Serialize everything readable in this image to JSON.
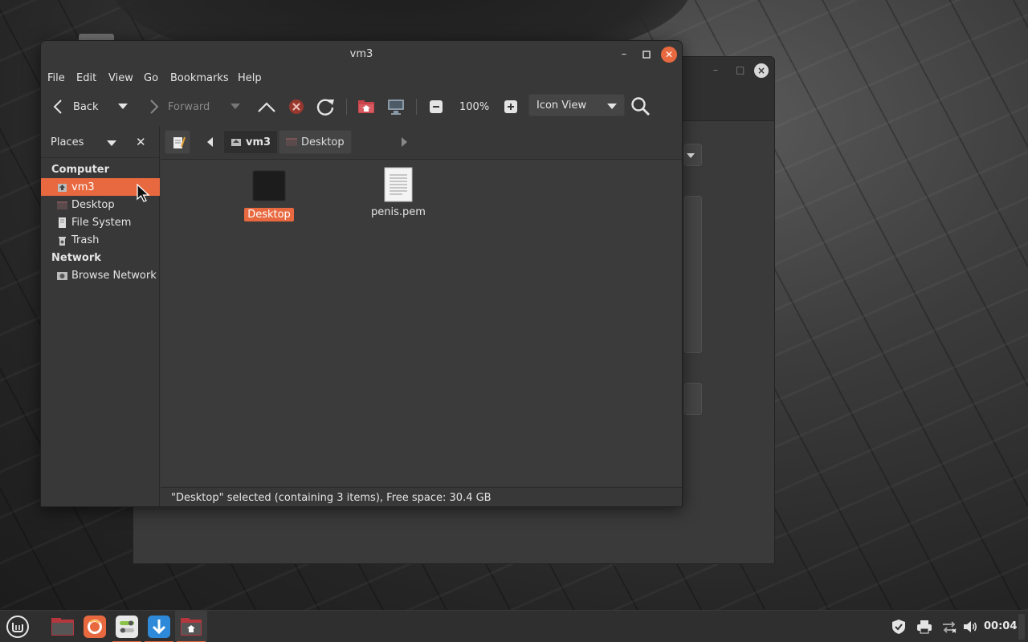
{
  "window": {
    "title": "vm3"
  },
  "menubar": {
    "items": [
      "File",
      "Edit",
      "View",
      "Go",
      "Bookmarks",
      "Help"
    ]
  },
  "toolbar": {
    "back_label": "Back",
    "forward_label": "Forward",
    "zoom_level": "100%",
    "view_mode": "Icon View"
  },
  "sidebar": {
    "header": "Places",
    "sections": [
      {
        "title": "Computer",
        "items": [
          "vm3",
          "Desktop",
          "File System",
          "Trash"
        ]
      },
      {
        "title": "Network",
        "items": [
          "Browse Network"
        ]
      }
    ],
    "active_item": "vm3"
  },
  "locationbar": {
    "crumbs": [
      "vm3",
      "Desktop"
    ]
  },
  "files": [
    {
      "name": "Desktop",
      "type": "folder",
      "selected": true
    },
    {
      "name": "penis.pem",
      "type": "text-document",
      "selected": false
    }
  ],
  "statusbar": {
    "text": "\"Desktop\" selected (containing 3 items), Free space: 30.4 GB"
  },
  "taskbar": {
    "clock": "00:04",
    "apps": [
      "mint-menu-icon",
      "file-manager-icon",
      "firefox-icon",
      "settings-icon",
      "update-manager-icon",
      "file-manager-window-icon"
    ]
  },
  "colors": {
    "accent": "#e8693f",
    "window_bg": "#383838",
    "content_bg": "#3b3b3b"
  }
}
